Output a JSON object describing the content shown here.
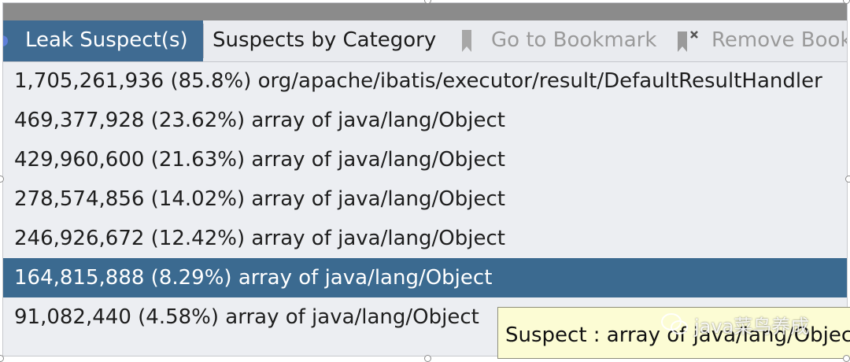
{
  "toolbar": {
    "leak_suspects": "Leak Suspect(s)",
    "suspects_by_category": "Suspects by Category",
    "go_to_bookmark": "Go to Bookmark",
    "remove_bookmark": "Remove Book"
  },
  "rows": [
    "1,705,261,936 (85.8%) org/apache/ibatis/executor/result/DefaultResultHandler",
    "469,377,928 (23.62%) array of java/lang/Object",
    "429,960,600 (21.63%) array of java/lang/Object",
    "278,574,856 (14.02%) array of java/lang/Object",
    "246,926,672 (12.42%) array of java/lang/Object",
    "164,815,888 (8.29%) array of java/lang/Object",
    "91,082,440 (4.58%) array of java/lang/Object"
  ],
  "selected_row": 5,
  "tooltip": "Suspect : array of java/lang/Object",
  "watermark": "java菜鸟养成",
  "colors": {
    "selection": "#3b6a90",
    "tooltip_bg": "#fcfcd4",
    "toolbar_bg": "#e9ebef"
  }
}
